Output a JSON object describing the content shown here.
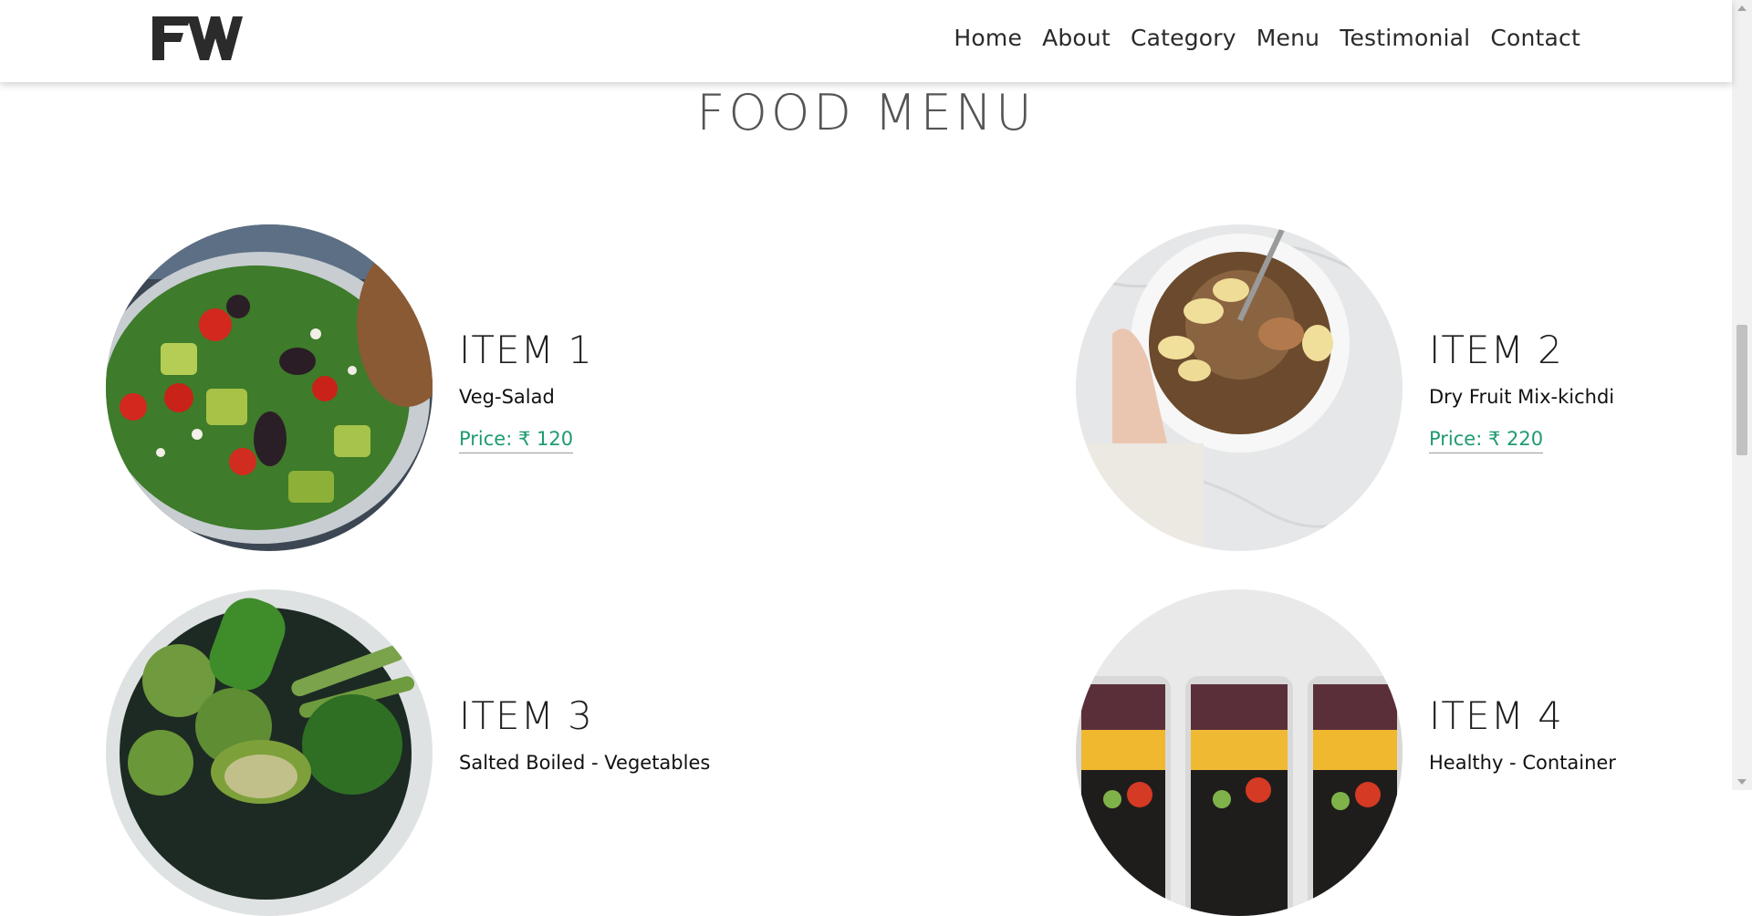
{
  "nav": {
    "logo_text": "FW",
    "links": [
      "Home",
      "About",
      "Category",
      "Menu",
      "Testimonial",
      "Contact"
    ]
  },
  "section": {
    "title": "FOOD MENU"
  },
  "items": [
    {
      "title": "ITEM 1",
      "name": "Veg-Salad",
      "price": "Price: ₹ 120",
      "image_icon": "salad-bowl-photo"
    },
    {
      "title": "ITEM 2",
      "name": "Dry Fruit Mix-kichdi",
      "price": "Price: ₹ 220",
      "image_icon": "granola-bowl-photo"
    },
    {
      "title": "ITEM 3",
      "name": "Salted Boiled - Vegetables",
      "price": "",
      "image_icon": "green-vegetables-photo"
    },
    {
      "title": "ITEM 4",
      "name": "Healthy - Container",
      "price": "",
      "image_icon": "meal-containers-photo"
    }
  ],
  "colors": {
    "price": "#1f9a74",
    "title": "#555555",
    "nav_text": "#2a2a2a"
  }
}
